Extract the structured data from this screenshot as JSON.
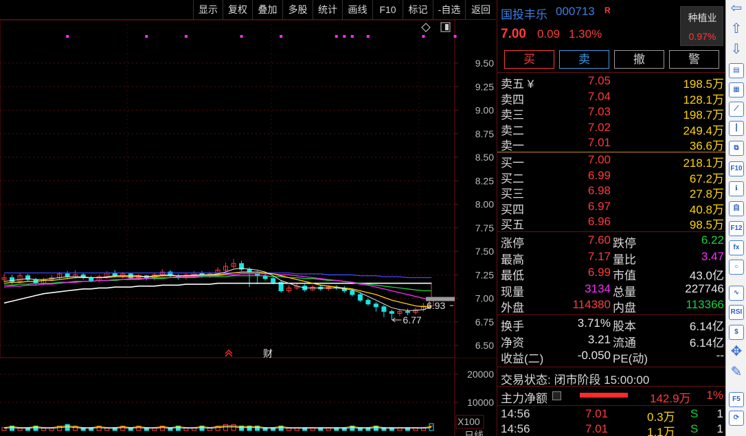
{
  "toolbar": {
    "items": [
      "显示",
      "复权",
      "叠加",
      "多股",
      "统计",
      "画线",
      "F10",
      "标记",
      "-自选",
      "返回"
    ]
  },
  "chart": {
    "price_ticks": [
      "9.50",
      "9.25",
      "9.00",
      "8.75",
      "8.50",
      "8.25",
      "8.00",
      "7.75",
      "7.50",
      "7.25",
      "7.00",
      "6.75",
      "6.50"
    ],
    "volume_ticks": [
      "20000",
      "10000"
    ],
    "volume_unit": "X100",
    "period_label": "日线",
    "low_annotation": "6.77",
    "last_annotation": "6.93",
    "finance_marker": "财",
    "colors": {
      "up": "#ff3b3b",
      "down": "#18e5e5",
      "ma5": "#ffffff",
      "ma10": "#ffd400",
      "ma20": "#ff2bff",
      "ma30": "#18d33c",
      "ma60": "#3a4cff"
    }
  },
  "chart_data": {
    "type": "candlestick",
    "ylim": [
      6.5,
      9.5
    ],
    "candles": [
      {
        "o": 7.2,
        "c": 7.22,
        "h": 7.26,
        "l": 7.17
      },
      {
        "o": 7.22,
        "c": 7.18,
        "h": 7.25,
        "l": 7.15
      },
      {
        "o": 7.18,
        "c": 7.24,
        "h": 7.27,
        "l": 7.16
      },
      {
        "o": 7.24,
        "c": 7.2,
        "h": 7.26,
        "l": 7.18
      },
      {
        "o": 7.2,
        "c": 7.16,
        "h": 7.22,
        "l": 7.14
      },
      {
        "o": 7.16,
        "c": 7.2,
        "h": 7.22,
        "l": 7.14
      },
      {
        "o": 7.2,
        "c": 7.22,
        "h": 7.25,
        "l": 7.18
      },
      {
        "o": 7.22,
        "c": 7.26,
        "h": 7.28,
        "l": 7.2
      },
      {
        "o": 7.26,
        "c": 7.23,
        "h": 7.29,
        "l": 7.21
      },
      {
        "o": 7.23,
        "c": 7.25,
        "h": 7.3,
        "l": 7.21
      },
      {
        "o": 7.25,
        "c": 7.22,
        "h": 7.27,
        "l": 7.2
      },
      {
        "o": 7.22,
        "c": 7.19,
        "h": 7.24,
        "l": 7.17
      },
      {
        "o": 7.19,
        "c": 7.23,
        "h": 7.25,
        "l": 7.17
      },
      {
        "o": 7.23,
        "c": 7.27,
        "h": 7.29,
        "l": 7.21
      },
      {
        "o": 7.27,
        "c": 7.24,
        "h": 7.3,
        "l": 7.22
      },
      {
        "o": 7.24,
        "c": 7.26,
        "h": 7.28,
        "l": 7.21
      },
      {
        "o": 7.26,
        "c": 7.22,
        "h": 7.27,
        "l": 7.2
      },
      {
        "o": 7.22,
        "c": 7.24,
        "h": 7.26,
        "l": 7.2
      },
      {
        "o": 7.24,
        "c": 7.21,
        "h": 7.25,
        "l": 7.19
      },
      {
        "o": 7.21,
        "c": 7.25,
        "h": 7.27,
        "l": 7.19
      },
      {
        "o": 7.25,
        "c": 7.28,
        "h": 7.31,
        "l": 7.23
      },
      {
        "o": 7.28,
        "c": 7.24,
        "h": 7.3,
        "l": 7.22
      },
      {
        "o": 7.24,
        "c": 7.22,
        "h": 7.26,
        "l": 7.2
      },
      {
        "o": 7.22,
        "c": 7.25,
        "h": 7.27,
        "l": 7.2
      },
      {
        "o": 7.25,
        "c": 7.27,
        "h": 7.29,
        "l": 7.23
      },
      {
        "o": 7.27,
        "c": 7.24,
        "h": 7.29,
        "l": 7.22
      },
      {
        "o": 7.24,
        "c": 7.26,
        "h": 7.28,
        "l": 7.22
      },
      {
        "o": 7.26,
        "c": 7.3,
        "h": 7.33,
        "l": 7.24
      },
      {
        "o": 7.3,
        "c": 7.34,
        "h": 7.38,
        "l": 7.28
      },
      {
        "o": 7.34,
        "c": 7.37,
        "h": 7.42,
        "l": 7.32
      },
      {
        "o": 7.37,
        "c": 7.31,
        "h": 7.4,
        "l": 7.29
      },
      {
        "o": 7.31,
        "c": 7.27,
        "h": 7.33,
        "l": 7.12
      },
      {
        "o": 7.27,
        "c": 7.24,
        "h": 7.29,
        "l": 7.15
      },
      {
        "o": 7.24,
        "c": 7.21,
        "h": 7.26,
        "l": 7.19
      },
      {
        "o": 7.21,
        "c": 7.17,
        "h": 7.23,
        "l": 7.15
      },
      {
        "o": 7.17,
        "c": 7.08,
        "h": 7.19,
        "l": 7.06
      },
      {
        "o": 7.08,
        "c": 7.11,
        "h": 7.14,
        "l": 7.06
      },
      {
        "o": 7.11,
        "c": 7.13,
        "h": 7.16,
        "l": 7.09
      },
      {
        "o": 7.13,
        "c": 7.09,
        "h": 7.15,
        "l": 7.07
      },
      {
        "o": 7.09,
        "c": 7.12,
        "h": 7.14,
        "l": 7.08
      },
      {
        "o": 7.12,
        "c": 7.1,
        "h": 7.14,
        "l": 7.08
      },
      {
        "o": 7.1,
        "c": 7.12,
        "h": 7.14,
        "l": 7.08
      },
      {
        "o": 7.12,
        "c": 7.11,
        "h": 7.14,
        "l": 7.09
      },
      {
        "o": 7.11,
        "c": 7.08,
        "h": 7.13,
        "l": 7.06
      },
      {
        "o": 7.08,
        "c": 7.04,
        "h": 7.1,
        "l": 7.02
      },
      {
        "o": 7.04,
        "c": 6.98,
        "h": 7.06,
        "l": 6.96
      },
      {
        "o": 6.98,
        "c": 6.94,
        "h": 7.0,
        "l": 6.92
      },
      {
        "o": 6.94,
        "c": 6.91,
        "h": 6.96,
        "l": 6.86
      },
      {
        "o": 6.91,
        "c": 6.86,
        "h": 6.93,
        "l": 6.8
      },
      {
        "o": 6.86,
        "c": 6.84,
        "h": 6.88,
        "l": 6.77
      },
      {
        "o": 6.84,
        "c": 6.86,
        "h": 6.88,
        "l": 6.81
      },
      {
        "o": 6.86,
        "c": 6.85,
        "h": 6.89,
        "l": 6.82
      },
      {
        "o": 6.85,
        "c": 6.88,
        "h": 6.9,
        "l": 6.83
      },
      {
        "o": 6.88,
        "c": 6.92,
        "h": 6.95,
        "l": 6.86
      },
      {
        "o": 6.92,
        "c": 7.0,
        "h": 7.17,
        "l": 6.99
      }
    ],
    "ma5": [
      7.18,
      7.19,
      7.2,
      7.21,
      7.2,
      7.2,
      7.21,
      7.22,
      7.23,
      7.23,
      7.23,
      7.22,
      7.22,
      7.23,
      7.24,
      7.24,
      7.24,
      7.24,
      7.23,
      7.24,
      7.25,
      7.25,
      7.24,
      7.24,
      7.25,
      7.25,
      7.25,
      7.26,
      7.28,
      7.31,
      7.32,
      7.31,
      7.3,
      7.28,
      7.24,
      7.19,
      7.16,
      7.13,
      7.11,
      7.11,
      7.11,
      7.11,
      7.11,
      7.1,
      7.09,
      7.06,
      7.02,
      6.98,
      6.94,
      6.9,
      6.88,
      6.87,
      6.87,
      6.88,
      6.91
    ],
    "ma10": [
      7.16,
      7.17,
      7.17,
      7.18,
      7.18,
      7.19,
      7.19,
      7.2,
      7.21,
      7.22,
      7.22,
      7.22,
      7.22,
      7.22,
      7.23,
      7.23,
      7.23,
      7.23,
      7.23,
      7.23,
      7.24,
      7.24,
      7.24,
      7.24,
      7.24,
      7.25,
      7.25,
      7.25,
      7.26,
      7.27,
      7.28,
      7.28,
      7.28,
      7.27,
      7.26,
      7.24,
      7.22,
      7.2,
      7.18,
      7.16,
      7.14,
      7.13,
      7.12,
      7.11,
      7.1,
      7.08,
      7.06,
      7.04,
      7.01,
      6.98,
      6.96,
      6.94,
      6.92,
      6.91,
      6.91
    ],
    "ma20": [
      7.12,
      7.13,
      7.13,
      7.14,
      7.14,
      7.15,
      7.15,
      7.16,
      7.17,
      7.17,
      7.18,
      7.18,
      7.19,
      7.19,
      7.2,
      7.2,
      7.21,
      7.21,
      7.21,
      7.22,
      7.22,
      7.22,
      7.23,
      7.23,
      7.23,
      7.24,
      7.24,
      7.24,
      7.25,
      7.25,
      7.26,
      7.26,
      7.26,
      7.26,
      7.26,
      7.25,
      7.25,
      7.24,
      7.23,
      7.22,
      7.21,
      7.2,
      7.19,
      7.18,
      7.17,
      7.15,
      7.14,
      7.12,
      7.1,
      7.08,
      7.06,
      7.04,
      7.02,
      7.0,
      6.99
    ],
    "ma30": [
      7.14,
      7.14,
      7.15,
      7.15,
      7.16,
      7.16,
      7.16,
      7.17,
      7.17,
      7.18,
      7.18,
      7.18,
      7.19,
      7.19,
      7.19,
      7.2,
      7.2,
      7.2,
      7.21,
      7.21,
      7.21,
      7.22,
      7.22,
      7.22,
      7.22,
      7.23,
      7.23,
      7.23,
      7.23,
      7.24,
      7.24,
      7.24,
      7.24,
      7.24,
      7.23,
      7.23,
      7.22,
      7.22,
      7.21,
      7.21,
      7.2,
      7.19,
      7.19,
      7.18,
      7.17,
      7.16,
      7.15,
      7.14,
      7.13,
      7.12,
      7.11,
      7.1,
      7.09,
      7.08,
      7.08
    ],
    "ma60": [
      7.27,
      7.27,
      7.27,
      7.27,
      7.27,
      7.27,
      7.27,
      7.27,
      7.27,
      7.27,
      7.27,
      7.27,
      7.27,
      7.27,
      7.27,
      7.27,
      7.27,
      7.27,
      7.27,
      7.27,
      7.27,
      7.27,
      7.27,
      7.27,
      7.27,
      7.27,
      7.27,
      7.27,
      7.27,
      7.27,
      7.27,
      7.27,
      7.27,
      7.27,
      7.27,
      7.27,
      7.27,
      7.26,
      7.26,
      7.26,
      7.26,
      7.25,
      7.25,
      7.25,
      7.25,
      7.24,
      7.24,
      7.24,
      7.23,
      7.23,
      7.23,
      7.22,
      7.22,
      7.22,
      7.22
    ],
    "ma_long": [
      6.95,
      6.97,
      6.99,
      7.01,
      7.03,
      7.05,
      7.06,
      7.07,
      7.08,
      7.09,
      7.1,
      7.1,
      7.11,
      7.11,
      7.12,
      7.12,
      7.12,
      7.13,
      7.13,
      7.13,
      7.14,
      7.14,
      7.14,
      7.15,
      7.15,
      7.15,
      7.15,
      7.16,
      7.16,
      7.16,
      7.16,
      7.16,
      7.16,
      7.16,
      7.16,
      7.16,
      7.16,
      7.16,
      7.16,
      7.16,
      7.16,
      7.16,
      7.16,
      7.16,
      7.16,
      7.16,
      7.16,
      7.16,
      7.16,
      7.16,
      7.16,
      7.16,
      7.16,
      7.16,
      7.16
    ],
    "volumes": [
      2,
      3,
      2,
      2,
      3,
      2,
      2,
      3,
      4,
      3,
      2,
      2,
      3,
      2,
      2,
      3,
      2,
      3,
      2,
      2,
      3,
      2,
      3,
      2,
      2,
      3,
      2,
      3,
      4,
      4,
      3,
      3,
      3,
      2,
      2,
      3,
      2,
      2,
      2,
      2,
      2,
      2,
      2,
      2,
      3,
      2,
      2,
      3,
      2,
      2,
      2,
      2,
      2,
      2,
      3
    ],
    "markers_x_index": [
      8,
      18,
      23,
      30,
      35,
      42,
      43,
      44,
      46,
      53,
      57
    ]
  },
  "quote": {
    "name": "国投丰乐",
    "code": "000713",
    "r_mark": "R",
    "last_price": "7.00",
    "change": "0.09",
    "change_pct": "1.30%",
    "industry_name": "种植业",
    "industry_pct": "0.97%",
    "buttons": {
      "buy": "买",
      "sell": "卖",
      "cancel": "撤",
      "alert": "警"
    },
    "asks": [
      {
        "label": "卖五 ¥",
        "price": "7.05",
        "vol": "198.5万"
      },
      {
        "label": "卖四",
        "price": "7.04",
        "vol": "128.1万"
      },
      {
        "label": "卖三",
        "price": "7.03",
        "vol": "198.7万"
      },
      {
        "label": "卖二",
        "price": "7.02",
        "vol": "249.4万"
      },
      {
        "label": "卖一",
        "price": "7.01",
        "vol": "36.6万"
      }
    ],
    "bids": [
      {
        "label": "买一",
        "price": "7.00",
        "vol": "218.1万"
      },
      {
        "label": "买二",
        "price": "6.99",
        "vol": "67.2万"
      },
      {
        "label": "买三",
        "price": "6.98",
        "vol": "27.8万"
      },
      {
        "label": "买四",
        "price": "6.97",
        "vol": "40.8万"
      },
      {
        "label": "买五",
        "price": "6.96",
        "vol": "98.5万"
      }
    ],
    "stats": [
      {
        "l1": "涨停",
        "v1": "7.60",
        "c1": "red",
        "l2": "跌停",
        "v2": "6.22",
        "c2": "green"
      },
      {
        "l1": "最高",
        "v1": "7.17",
        "c1": "red",
        "l2": "量比",
        "v2": "3.47",
        "c2": "magenta"
      },
      {
        "l1": "最低",
        "v1": "6.99",
        "c1": "red",
        "l2": "市值",
        "v2": "43.0亿",
        "c2": "white"
      },
      {
        "l1": "现量",
        "v1": "3134",
        "c1": "magenta",
        "l2": "总量",
        "v2": "227746",
        "c2": "white"
      },
      {
        "l1": "外盘",
        "v1": "114380",
        "c1": "red",
        "l2": "内盘",
        "v2": "113366",
        "c2": "green"
      }
    ],
    "stats2": [
      {
        "l1": "换手",
        "v1": "3.71%",
        "c1": "white",
        "l2": "股本",
        "v2": "6.14亿",
        "c2": "white"
      },
      {
        "l1": "净资",
        "v1": "3.21",
        "c1": "white",
        "l2": "流通",
        "v2": "6.14亿",
        "c2": "white"
      },
      {
        "l1": "收益(二)",
        "v1": "-0.050",
        "c1": "white",
        "l2": "PE(动)",
        "v2": "--",
        "c2": "white"
      }
    ],
    "trade_status": "交易状态: 闭市阶段 15:00:00",
    "main_flow_label": "主力净额",
    "main_flow_value": "142.9万",
    "main_flow_pct": "1%",
    "ticks": [
      {
        "time": "14:56",
        "price": "7.01",
        "vol": "0.3万",
        "side": "S",
        "num": "1"
      },
      {
        "time": "14:56",
        "price": "7.01",
        "vol": "1.1万",
        "side": "S",
        "num": "1"
      }
    ]
  },
  "iconbar": {
    "labels": [
      "F10",
      "F5",
      "RSI"
    ]
  }
}
